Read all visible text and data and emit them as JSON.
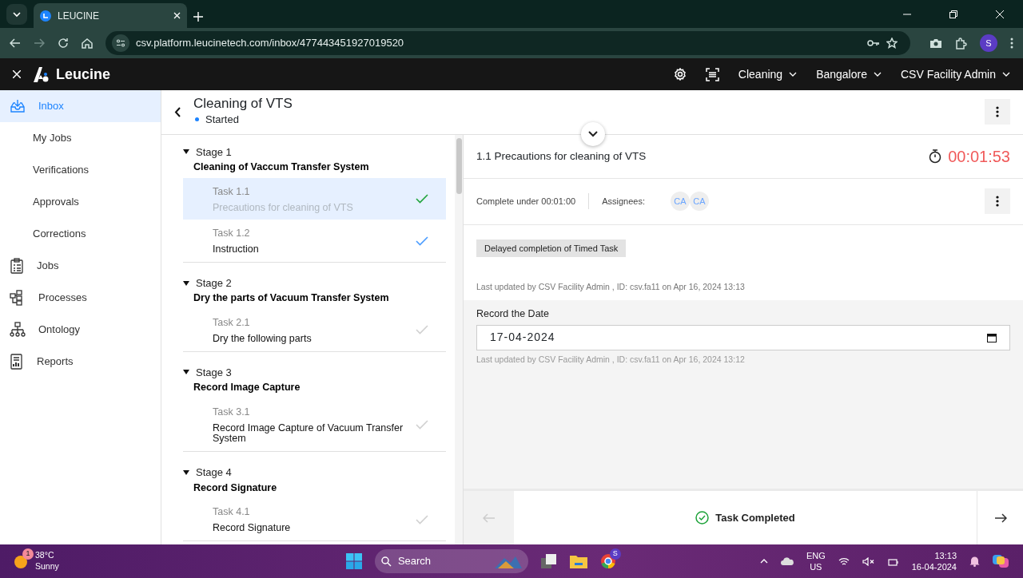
{
  "browser": {
    "tab_title": "LEUCINE",
    "url": "csv.platform.leucinetech.com/inbox/477443451927019520",
    "profile_initial": "S"
  },
  "app_header": {
    "brand": "Leucine",
    "menus": [
      "Cleaning",
      "Bangalore",
      "CSV Facility Admin"
    ]
  },
  "sidebar": {
    "items": [
      {
        "label": "Inbox",
        "selected": true,
        "children": [
          {
            "label": "My Jobs",
            "selected": false
          },
          {
            "label": "Verifications",
            "selected": false
          },
          {
            "label": "Approvals",
            "selected": false
          },
          {
            "label": "Corrections",
            "selected": false
          }
        ]
      },
      {
        "label": "Jobs",
        "selected": false
      },
      {
        "label": "Processes",
        "selected": false
      },
      {
        "label": "Ontology",
        "selected": false
      },
      {
        "label": "Reports",
        "selected": false
      }
    ]
  },
  "job": {
    "title": "Cleaning of VTS",
    "status": "Started"
  },
  "stages": [
    {
      "label": "Stage 1",
      "name": "Cleaning of Vaccum Transfer System",
      "expanded": true,
      "tasks": [
        {
          "number": "Task 1.1",
          "name": "Precautions for cleaning of VTS",
          "selected": true,
          "color": "#1fa33b"
        },
        {
          "number": "Task 1.2",
          "name": "Instruction",
          "selected": false,
          "color": "#4a9cff"
        }
      ]
    },
    {
      "label": "Stage 2",
      "name": "Dry the parts of Vacuum Transfer System",
      "expanded": true,
      "tasks": [
        {
          "number": "Task 2.1",
          "name": "Dry the following parts",
          "selected": false,
          "color": "#d0d0d0"
        }
      ]
    },
    {
      "label": "Stage 3",
      "name": "Record Image Capture",
      "expanded": true,
      "tasks": [
        {
          "number": "Task 3.1",
          "name": "Record Image Capture of Vacuum Transfer System",
          "selected": false,
          "color": "#d0d0d0"
        }
      ]
    },
    {
      "label": "Stage 4",
      "name": "Record Signature",
      "expanded": true,
      "tasks": [
        {
          "number": "Task 4.1",
          "name": "Record Signature",
          "selected": false,
          "color": "#d0d0d0"
        }
      ]
    }
  ],
  "task_panel": {
    "title": "1.1 Precautions for cleaning of VTS",
    "timer": "00:01:53",
    "complete_under": "Complete under 00:01:00",
    "assignees_label": "Assignees:",
    "assignees": [
      "CA",
      "CA"
    ],
    "badge": "Delayed completion of Timed Task",
    "last_updated": "Last updated by CSV Facility Admin , ID: csv.fa11 on Apr 16, 2024 13:13",
    "field": {
      "label": "Record the Date",
      "value": "17-04-2024",
      "last_updated": "Last updated by CSV Facility Admin , ID: csv.fa11 on Apr 16, 2024 13:12"
    },
    "footer_status": "Task Completed"
  },
  "taskbar": {
    "weather_badge": "1",
    "temperature": "38°C",
    "condition": "Sunny",
    "search_placeholder": "Search",
    "chrome_badge": "S",
    "language": "ENG",
    "region": "US",
    "time": "13:13",
    "date": "16-04-2024"
  }
}
